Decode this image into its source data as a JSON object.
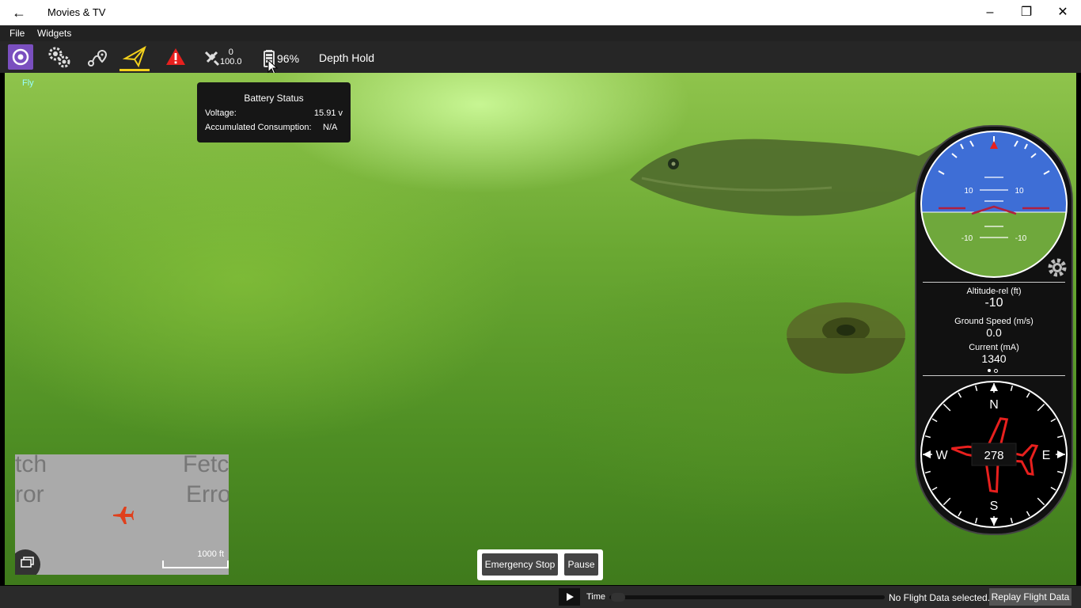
{
  "window": {
    "title": "Movies & TV"
  },
  "menu": {
    "file": "File",
    "widgets": "Widgets"
  },
  "toolbar": {
    "satellite_count": "0",
    "satellite_hdop": "100.0",
    "battery_percent": "96%",
    "flight_mode": "Depth Hold"
  },
  "view": {
    "fly_label": "Fly"
  },
  "battery_tooltip": {
    "title": "Battery Status",
    "voltage_label": "Voltage:",
    "voltage_value": "15.91 v",
    "consumption_label": "Accumulated Consumption:",
    "consumption_value": "N/A"
  },
  "minimap": {
    "ghost_text_1": "tch",
    "ghost_text_2": "ror",
    "ghost_text_3": "Fetc",
    "ghost_text_4": "Erro",
    "scale": "1000 ft"
  },
  "actions": {
    "emergency_stop": "Emergency Stop",
    "pause": "Pause"
  },
  "attitude": {
    "pitch_up_left": "10",
    "pitch_up_right": "10",
    "pitch_down_left": "-10",
    "pitch_down_right": "-10"
  },
  "values": {
    "altitude_label": "Altitude-rel (ft)",
    "altitude_value": "-10",
    "ground_speed_label": "Ground Speed (m/s)",
    "ground_speed_value": "0.0",
    "current_label": "Current (mA)",
    "current_value": "1340"
  },
  "compass": {
    "heading": "278",
    "n": "N",
    "e": "E",
    "s": "S",
    "w": "W"
  },
  "playback": {
    "time_label": "Time",
    "status": "No Flight Data selected..",
    "replay_button": "Replay Flight Data"
  },
  "colors": {
    "accent_yellow": "#f2d01c",
    "warning_red": "#e8201e",
    "sky_blue": "#3e6ed6",
    "ground_green": "#6fa83c"
  }
}
